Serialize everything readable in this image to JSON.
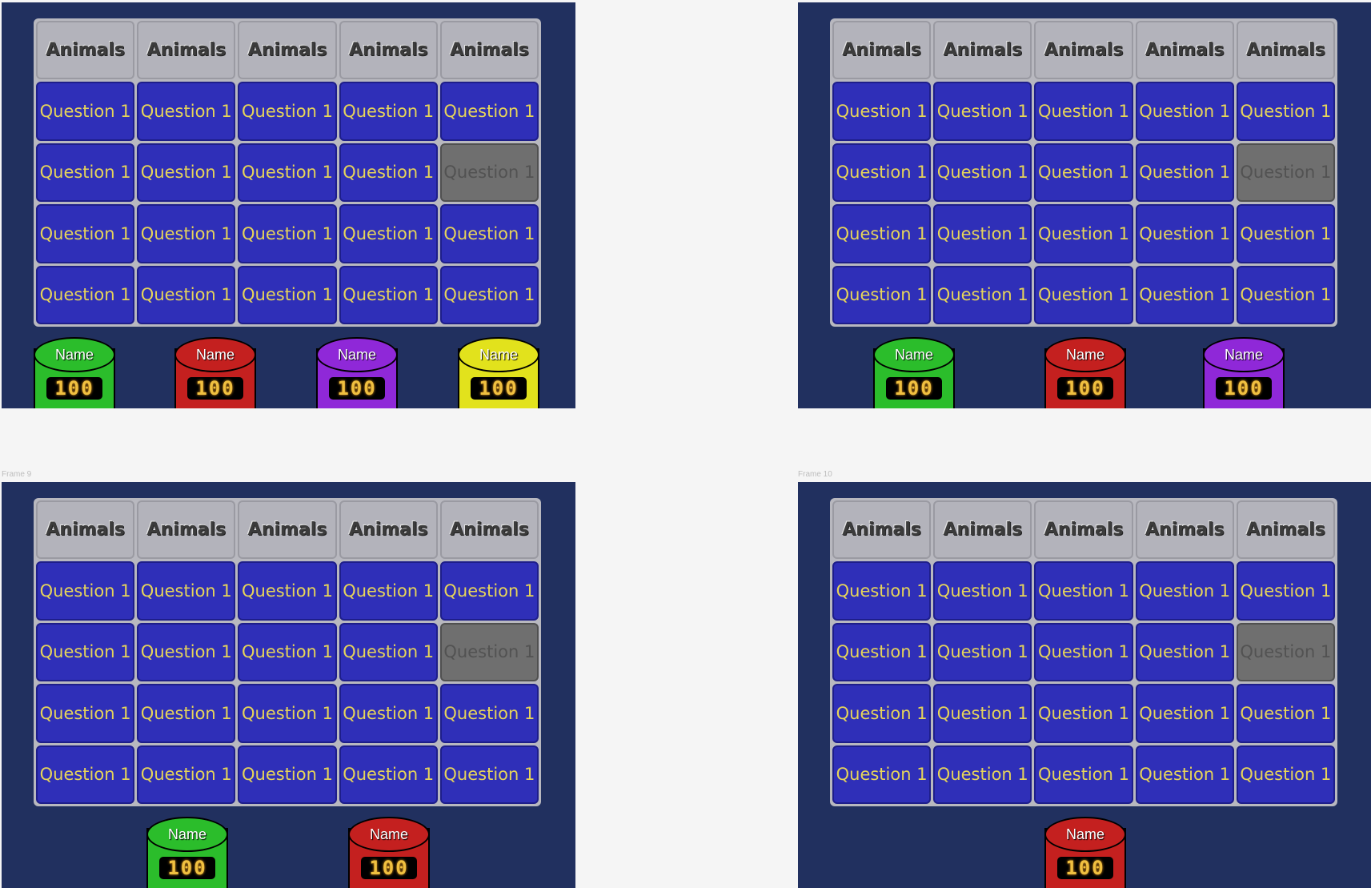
{
  "frames": [
    {
      "label": "",
      "categories": [
        "Animals",
        "Animals",
        "Animals",
        "Animals",
        "Animals"
      ],
      "rows": [
        [
          "Question 1",
          "Question 1",
          "Question 1",
          "Question 1",
          "Question 1"
        ],
        [
          "Question 1",
          "Question 1",
          "Question 1",
          "Question 1",
          "Question 1"
        ],
        [
          "Question 1",
          "Question 1",
          "Question 1",
          "Question 1",
          "Question 1"
        ],
        [
          "Question 1",
          "Question 1",
          "Question 1",
          "Question 1",
          "Question 1"
        ]
      ],
      "used": [
        [
          1,
          4
        ]
      ],
      "players": [
        {
          "name": "Name",
          "score": "100",
          "color": "#2bbd2b"
        },
        {
          "name": "Name",
          "score": "100",
          "color": "#c4201f"
        },
        {
          "name": "Name",
          "score": "100",
          "color": "#8f28d8"
        },
        {
          "name": "Name",
          "score": "100",
          "color": "#e2e21c"
        }
      ]
    },
    {
      "label": "",
      "categories": [
        "Animals",
        "Animals",
        "Animals",
        "Animals",
        "Animals"
      ],
      "rows": [
        [
          "Question 1",
          "Question 1",
          "Question 1",
          "Question 1",
          "Question 1"
        ],
        [
          "Question 1",
          "Question 1",
          "Question 1",
          "Question 1",
          "Question 1"
        ],
        [
          "Question 1",
          "Question 1",
          "Question 1",
          "Question 1",
          "Question 1"
        ],
        [
          "Question 1",
          "Question 1",
          "Question 1",
          "Question 1",
          "Question 1"
        ]
      ],
      "used": [
        [
          1,
          4
        ]
      ],
      "players": [
        {
          "name": "Name",
          "score": "100",
          "color": "#2bbd2b"
        },
        {
          "name": "Name",
          "score": "100",
          "color": "#c4201f"
        },
        {
          "name": "Name",
          "score": "100",
          "color": "#8f28d8"
        }
      ]
    },
    {
      "label": "Frame 9",
      "categories": [
        "Animals",
        "Animals",
        "Animals",
        "Animals",
        "Animals"
      ],
      "rows": [
        [
          "Question 1",
          "Question 1",
          "Question 1",
          "Question 1",
          "Question 1"
        ],
        [
          "Question 1",
          "Question 1",
          "Question 1",
          "Question 1",
          "Question 1"
        ],
        [
          "Question 1",
          "Question 1",
          "Question 1",
          "Question 1",
          "Question 1"
        ],
        [
          "Question 1",
          "Question 1",
          "Question 1",
          "Question 1",
          "Question 1"
        ]
      ],
      "used": [
        [
          1,
          4
        ]
      ],
      "players": [
        {
          "name": "Name",
          "score": "100",
          "color": "#2bbd2b"
        },
        {
          "name": "Name",
          "score": "100",
          "color": "#c4201f"
        }
      ]
    },
    {
      "label": "Frame 10",
      "categories": [
        "Animals",
        "Animals",
        "Animals",
        "Animals",
        "Animals"
      ],
      "rows": [
        [
          "Question 1",
          "Question 1",
          "Question 1",
          "Question 1",
          "Question 1"
        ],
        [
          "Question 1",
          "Question 1",
          "Question 1",
          "Question 1",
          "Question 1"
        ],
        [
          "Question 1",
          "Question 1",
          "Question 1",
          "Question 1",
          "Question 1"
        ],
        [
          "Question 1",
          "Question 1",
          "Question 1",
          "Question 1",
          "Question 1"
        ]
      ],
      "used": [
        [
          1,
          4
        ]
      ],
      "players": [
        {
          "name": "Name",
          "score": "100",
          "color": "#c4201f"
        }
      ]
    }
  ]
}
